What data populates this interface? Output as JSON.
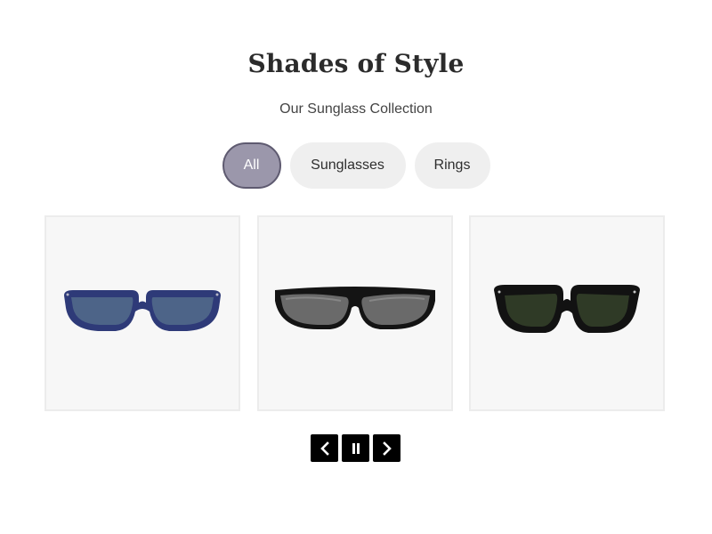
{
  "header": {
    "title": "Shades of Style",
    "subtitle": "Our Sunglass Collection"
  },
  "filters": [
    {
      "label": "All",
      "active": true
    },
    {
      "label": "Sunglasses",
      "active": false
    },
    {
      "label": "Rings",
      "active": false
    }
  ],
  "products": [
    {
      "name": "blue-wayfarer-sunglasses",
      "frame_color": "#2e3a78",
      "lens_color": "#4d6488",
      "temple_color": "#8a2a26"
    },
    {
      "name": "black-wrap-sunglasses",
      "frame_color": "#141414",
      "lens_color": "#6a6a6a"
    },
    {
      "name": "black-wayfarer-green-lens-sunglasses",
      "frame_color": "#121212",
      "lens_color": "#2f3a26"
    }
  ],
  "carousel_controls": {
    "icons": [
      "chevron-left-icon",
      "pause-icon",
      "chevron-right-icon"
    ]
  },
  "colors": {
    "active_filter_bg": "#9b97ab",
    "active_filter_border": "#5e5a70",
    "inactive_filter_bg": "#efefef",
    "control_bg": "#000000"
  }
}
